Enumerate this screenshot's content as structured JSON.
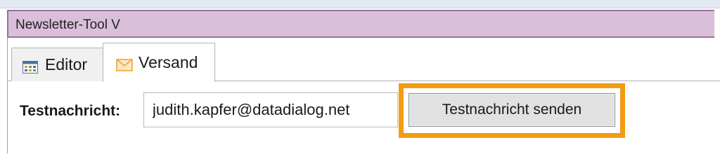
{
  "window": {
    "title": "Newsletter-Tool V"
  },
  "tabs": [
    {
      "label": "Editor",
      "icon": "table-grid-icon",
      "active": false
    },
    {
      "label": "Versand",
      "icon": "envelope-icon",
      "active": true
    }
  ],
  "form": {
    "label": "Testnachricht:",
    "email_value": "judith.kapfer@datadialog.net",
    "send_button_label": "Testnachricht senden"
  },
  "colors": {
    "title_bar_bg": "#d9bfd9",
    "title_bar_border": "#9a6f9c",
    "highlight": "#f39c11"
  }
}
